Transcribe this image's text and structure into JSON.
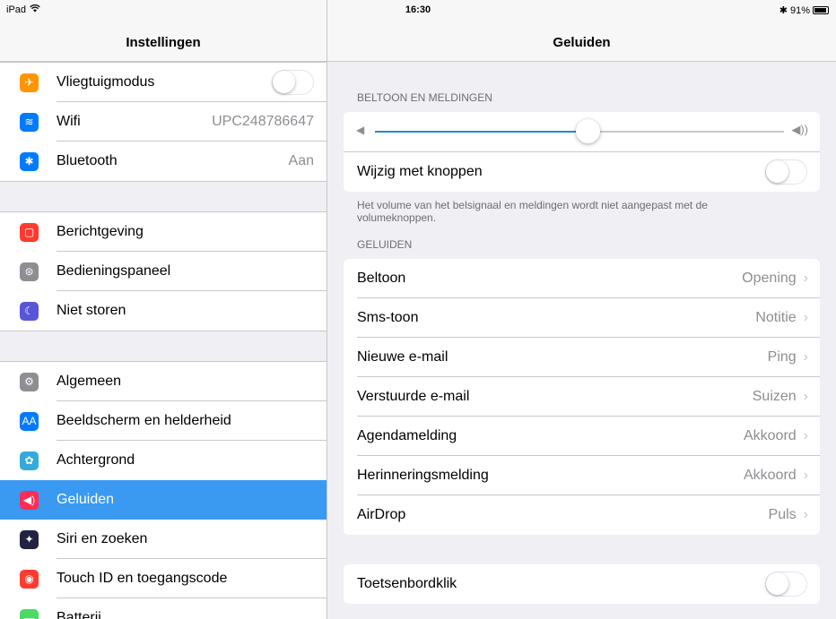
{
  "status": {
    "device": "iPad",
    "time": "16:30",
    "bluetooth_symbol": "✱",
    "battery": "91%"
  },
  "sidebar": {
    "title": "Instellingen",
    "group1": [
      {
        "icon": "airplane-icon",
        "color": "#ff9500",
        "glyph": "✈",
        "label": "Vliegtuigmodus",
        "toggle": false
      },
      {
        "icon": "wifi-icon",
        "color": "#007aff",
        "glyph": "≋",
        "label": "Wifi",
        "value": "UPC248786647"
      },
      {
        "icon": "bluetooth-icon",
        "color": "#007aff",
        "glyph": "✱",
        "label": "Bluetooth",
        "value": "Aan"
      }
    ],
    "group2": [
      {
        "icon": "notifications-icon",
        "color": "#ff3b30",
        "glyph": "▢",
        "label": "Berichtgeving"
      },
      {
        "icon": "control-center-icon",
        "color": "#8e8e93",
        "glyph": "⊜",
        "label": "Bedieningspaneel"
      },
      {
        "icon": "moon-icon",
        "color": "#5856d6",
        "glyph": "☾",
        "label": "Niet storen"
      }
    ],
    "group3": [
      {
        "icon": "gear-icon",
        "color": "#8e8e93",
        "glyph": "⚙",
        "label": "Algemeen"
      },
      {
        "icon": "display-icon",
        "color": "#007aff",
        "glyph": "AA",
        "label": "Beeldscherm en helderheid"
      },
      {
        "icon": "wallpaper-icon",
        "color": "#34aadc",
        "glyph": "✿",
        "label": "Achtergrond"
      },
      {
        "icon": "sounds-icon",
        "color": "#ff2d55",
        "glyph": "◀)",
        "label": "Geluiden",
        "selected": true
      },
      {
        "icon": "siri-icon",
        "color": "#222244",
        "glyph": "✦",
        "label": "Siri en zoeken"
      },
      {
        "icon": "fingerprint-icon",
        "color": "#ff3b30",
        "glyph": "◉",
        "label": "Touch ID en toegangscode"
      },
      {
        "icon": "battery-icon",
        "color": "#4cd964",
        "glyph": "▬",
        "label": "Batterij"
      }
    ]
  },
  "main": {
    "title": "Geluiden",
    "ringer_header": "BELTOON EN MELDINGEN",
    "volume_level": 0.52,
    "change_with_buttons": "Wijzig met knoppen",
    "ringer_note": "Het volume van het belsignaal en meldingen wordt niet aangepast met de volumeknoppen.",
    "sounds_header": "GELUIDEN",
    "sounds": [
      {
        "label": "Beltoon",
        "value": "Opening"
      },
      {
        "label": "Sms-toon",
        "value": "Notitie"
      },
      {
        "label": "Nieuwe e-mail",
        "value": "Ping"
      },
      {
        "label": "Verstuurde e-mail",
        "value": "Suizen"
      },
      {
        "label": "Agendamelding",
        "value": "Akkoord"
      },
      {
        "label": "Herinneringsmelding",
        "value": "Akkoord"
      },
      {
        "label": "AirDrop",
        "value": "Puls"
      }
    ],
    "keyboard_clicks": "Toetsenbordklik"
  }
}
